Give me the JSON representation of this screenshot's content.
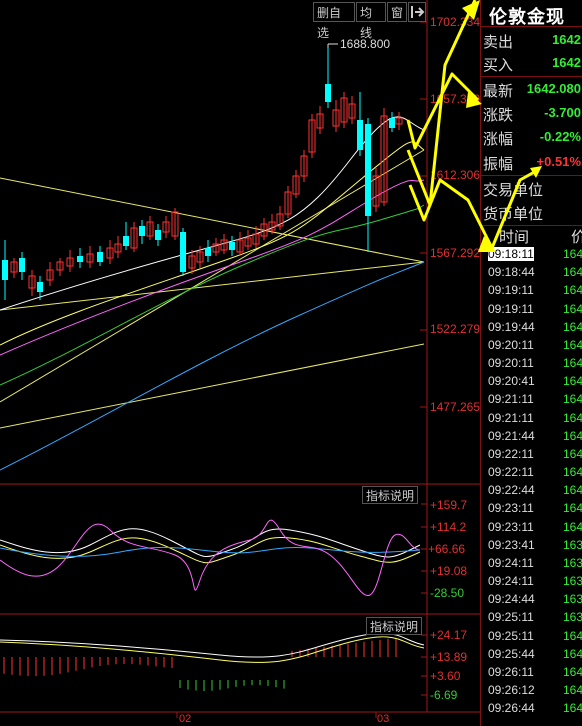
{
  "toolbar": {
    "delete_watch": "删自选",
    "ma_line": "均线",
    "window": "窗",
    "exit_icon": "arrow-exit-icon"
  },
  "price_axis": [
    "1702.334",
    "1657.320",
    "1612.306",
    "1567.292",
    "1522.279",
    "1477.265"
  ],
  "high_marker": "1688.800",
  "indicator1": {
    "button": "指标说明",
    "levels": [
      "+159.7",
      "+114.2",
      "+66.66",
      "+19.08",
      "-28.50"
    ]
  },
  "indicator2": {
    "button": "指标说明",
    "levels": [
      "+24.17",
      "+13.89",
      "+3.60",
      "-6.69"
    ]
  },
  "dates": [
    "02",
    "03"
  ],
  "side": {
    "title": "伦敦金现",
    "quotes": [
      {
        "label": "卖出",
        "value": "1642",
        "color": "green"
      },
      {
        "label": "买入",
        "value": "1642",
        "color": "green"
      },
      {
        "label": "最新",
        "value": "1642.080",
        "color": "green"
      },
      {
        "label": "涨跌",
        "value": "-3.700",
        "color": "green"
      },
      {
        "label": "涨幅",
        "value": "-0.22%",
        "color": "green"
      },
      {
        "label": "振幅",
        "value": "+0.51%",
        "color": "red"
      },
      {
        "label": "交易单位",
        "value": "",
        "color": "green"
      },
      {
        "label": "货币单位",
        "value": "",
        "color": "green"
      }
    ],
    "header_time": "时间",
    "header_price": "价",
    "ticks": [
      {
        "time": "09:18:11",
        "price": "164"
      },
      {
        "time": "09:18:44",
        "price": "164"
      },
      {
        "time": "09:19:11",
        "price": "164"
      },
      {
        "time": "09:19:11",
        "price": "164"
      },
      {
        "time": "09:19:44",
        "price": "164"
      },
      {
        "time": "09:20:11",
        "price": "164"
      },
      {
        "time": "09:20:11",
        "price": "164"
      },
      {
        "time": "09:20:41",
        "price": "164"
      },
      {
        "time": "09:21:11",
        "price": "164"
      },
      {
        "time": "09:21:11",
        "price": "164"
      },
      {
        "time": "09:21:44",
        "price": "164"
      },
      {
        "time": "09:22:11",
        "price": "164"
      },
      {
        "time": "09:22:11",
        "price": "164"
      },
      {
        "time": "09:22:44",
        "price": "164"
      },
      {
        "time": "09:23:11",
        "price": "164"
      },
      {
        "time": "09:23:11",
        "price": "164"
      },
      {
        "time": "09:23:41",
        "price": "163"
      },
      {
        "time": "09:24:11",
        "price": "163"
      },
      {
        "time": "09:24:11",
        "price": "163"
      },
      {
        "time": "09:24:44",
        "price": "163"
      },
      {
        "time": "09:25:11",
        "price": "163"
      },
      {
        "time": "09:25:11",
        "price": "164"
      },
      {
        "time": "09:25:44",
        "price": "164"
      },
      {
        "time": "09:26:11",
        "price": "164"
      },
      {
        "time": "09:26:12",
        "price": "164"
      },
      {
        "time": "09:26:44",
        "price": "164"
      }
    ]
  },
  "colors": {
    "up": "#ff3333",
    "down": "#00ffff",
    "accent_red": "#e03030",
    "annotation": "#ffff00"
  }
}
